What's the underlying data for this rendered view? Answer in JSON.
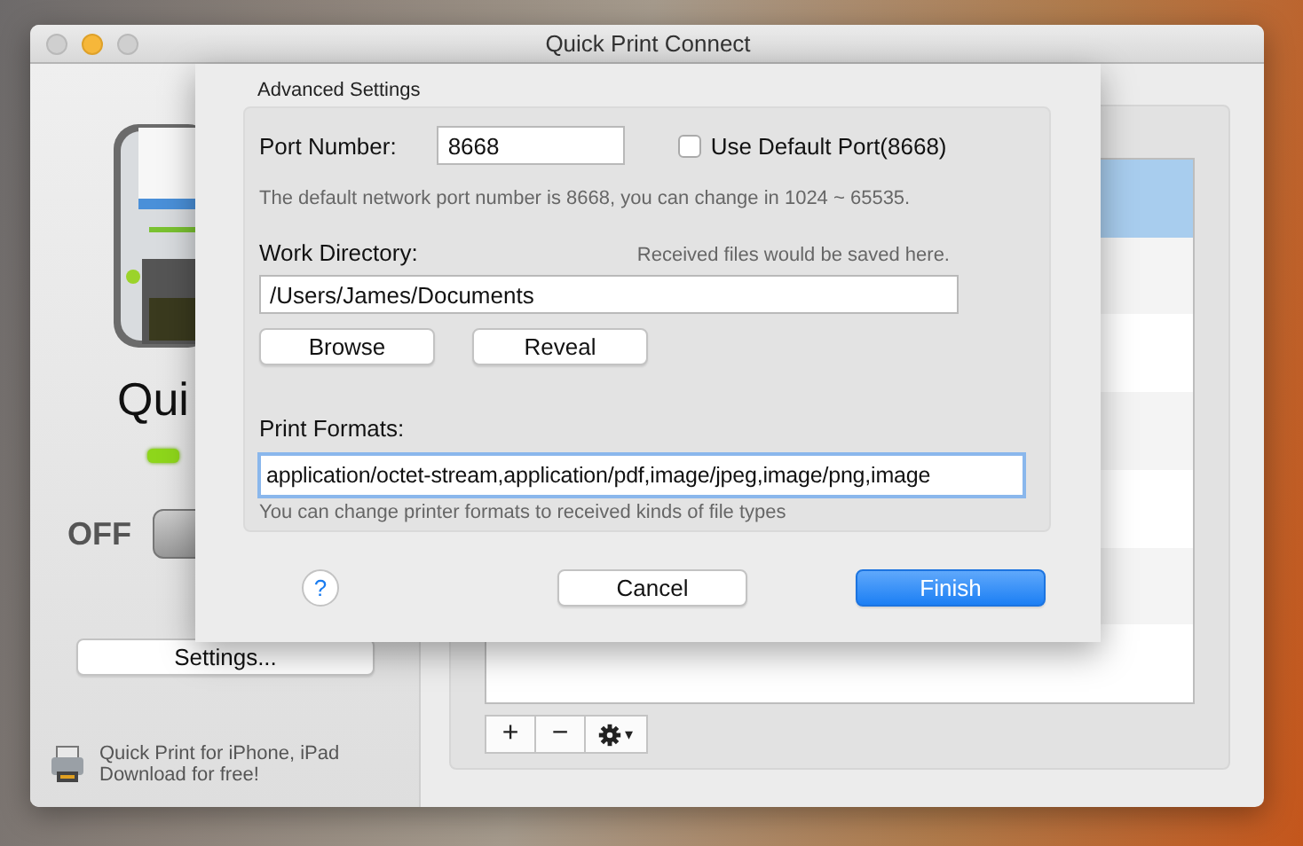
{
  "window": {
    "title": "Quick Print Connect"
  },
  "sidebar": {
    "app_name": "Qui",
    "switch_label": "OFF",
    "switch_on": false,
    "settings_button": "Settings...",
    "promo_lines": [
      "Quick Print for iPhone, iPad",
      "Download for free!"
    ]
  },
  "table": {
    "rows": [
      {
        "selected": true
      },
      {
        "selected": false
      },
      {
        "selected": false
      },
      {
        "selected": false
      },
      {
        "selected": false
      },
      {
        "selected": false
      },
      {
        "selected": false
      }
    ]
  },
  "toolbar": {
    "add": "+",
    "remove": "−",
    "menu_caret": "▾"
  },
  "sheet": {
    "title": "Advanced Settings",
    "port_label": "Port Number:",
    "port_value": "8668",
    "default_port": {
      "label": "Use Default Port(8668)",
      "checked": false
    },
    "port_hint": "The default network port number is 8668, you can change in 1024 ~ 65535.",
    "dir_label": "Work Directory:",
    "dir_hint": "Received files would be saved here.",
    "dir_value": "/Users/James/Documents",
    "buttons": [
      "Browse",
      "Reveal"
    ],
    "formats_label": "Print Formats:",
    "formats_value": "application/octet-stream,application/pdf,image/jpeg,image/png,image",
    "formats_hint": "You can change printer formats to received kinds of file types",
    "help": "?",
    "cancel": "Cancel",
    "finish": "Finish"
  }
}
